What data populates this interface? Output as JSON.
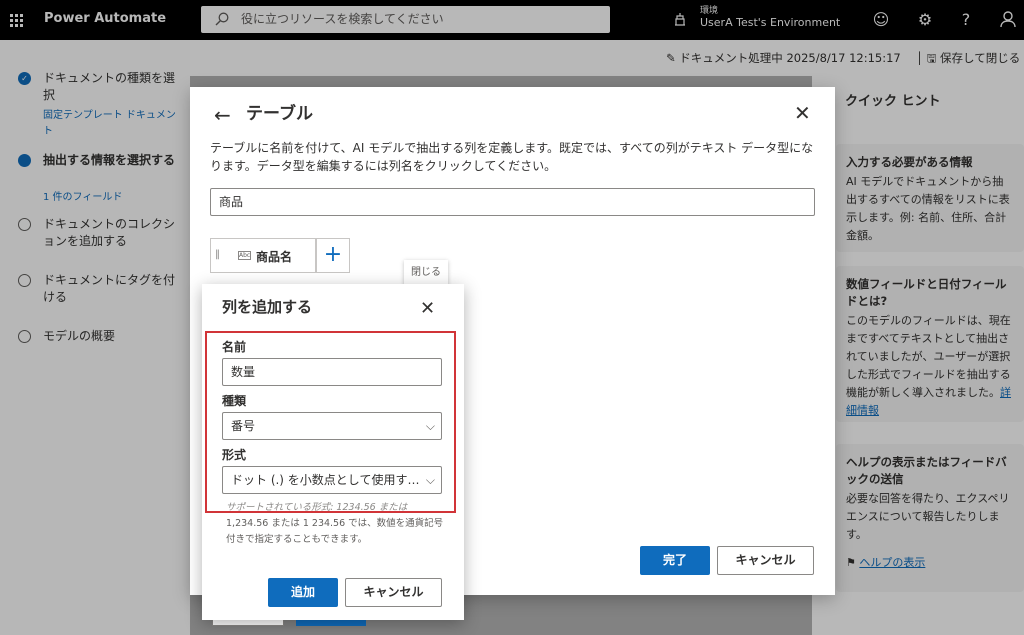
{
  "topbar": {
    "app_name": "Power Automate",
    "search_placeholder": "役に立つリソースを検索してください",
    "env_label": "環境",
    "env_name": "UserA Test's Environment"
  },
  "sidebar": {
    "steps": [
      {
        "label": "ドキュメントの種類を選択",
        "sub": "固定テンプレート ドキュメント",
        "state": "done"
      },
      {
        "label": "抽出する情報を選択する",
        "sub": "1 件のフィールド",
        "state": "current"
      },
      {
        "label": "ドキュメントのコレクションを追加する",
        "sub": "",
        "state": "todo"
      },
      {
        "label": "ドキュメントにタグを付ける",
        "sub": "",
        "state": "todo"
      },
      {
        "label": "モデルの概要",
        "sub": "",
        "state": "todo"
      }
    ]
  },
  "header": {
    "doc_status": "ドキュメント処理中 2025/8/17 12:15:17",
    "save_close": "保存して閉じる"
  },
  "hints": {
    "title": "クイック ヒント",
    "cards": [
      {
        "title": "入力する必要がある情報",
        "body": "AI モデルでドキュメントから抽出するすべての情報をリストに表示します。例: 名前、住所、合計金額。",
        "link": ""
      },
      {
        "title": "数値フィールドと日付フィールドとは?",
        "body": "このモデルのフィールドは、現在まですべてテキストとして抽出されていましたが、ユーザーが選択した形式でフィールドを抽出する機能が新しく導入されました。",
        "link": "詳細情報"
      },
      {
        "title": "ヘルプの表示またはフィードバックの送信",
        "body": "必要な回答を得たり、エクスペリエンスについて報告したりします。",
        "link": ""
      }
    ],
    "help_link": "ヘルプの表示"
  },
  "dialog": {
    "title": "テーブル",
    "description": "テーブルに名前を付けて、AI モデルで抽出する列を定義します。既定では、すべての列がテキスト データ型になります。データ型を編集するには列名をクリックしてください。",
    "table_name": "商品",
    "column_name": "商品名",
    "abc_icon_text": "Abc",
    "tooltip": "閉じる",
    "done": "完了",
    "cancel": "キャンセル"
  },
  "add_column": {
    "title": "列を追加する",
    "name_label": "名前",
    "name_value": "数量",
    "type_label": "種類",
    "type_value": "番号",
    "format_label": "形式",
    "format_value": "ドット (.) を小数点として使用す…",
    "hint_cut": "サポートされている形式: 1234.56 または",
    "hint": "1,234.56 または 1 234.56 では、数値を通貨記号付きで指定することもできます。",
    "add": "追加",
    "cancel": "キャンセル"
  },
  "colors": {
    "accent": "#0f6cbd",
    "highlight": "#d13438"
  }
}
